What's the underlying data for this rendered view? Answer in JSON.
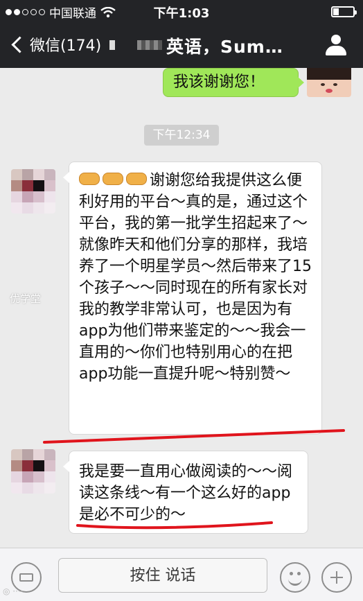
{
  "status_bar": {
    "carrier": "中国联通",
    "time": "下午1:03",
    "battery_level": 0.3
  },
  "nav": {
    "back_label": "微信(174)",
    "title": "英语，Sum…"
  },
  "messages": {
    "sent_1": "我该谢谢您！",
    "timestamp": "下午12:34",
    "watermark": "优学堂",
    "received_1": "谢谢您给我提供这么便利好用的平台～真的是，通过这个平台，我的第一批学生招起来了～就像昨天和他们分享的那样，我培养了一个明星学员～然后带来了15个孩子～～同时现在的所有家长对我的教学非常认可，也是因为有app为他们带来鉴定的～～我会一直用的～你们也特别用心的在把app功能一直提升呢～特别赞～",
    "received_2": "我是要一直用心做阅读的～～阅读这条线～有一个这么好的app是必不可少的～"
  },
  "input_bar": {
    "hold_to_talk": "按住 说话"
  },
  "colors": {
    "nav_bg": "#232427",
    "chat_bg": "#ebebeb",
    "sent_bubble": "#a0e759",
    "highlight_red": "#e0141c"
  }
}
